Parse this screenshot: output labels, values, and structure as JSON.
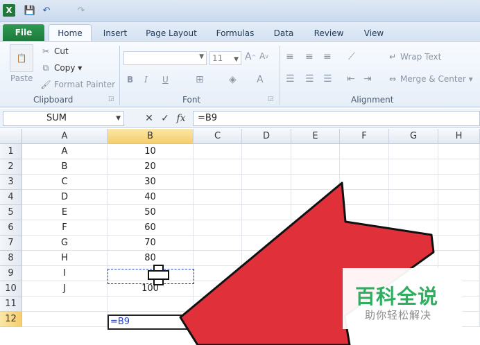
{
  "quick_access": {
    "logo": "X",
    "save": "💾",
    "undo": "↶",
    "redo": "↷"
  },
  "tabs": [
    "File",
    "Home",
    "Insert",
    "Page Layout",
    "Formulas",
    "Data",
    "Review",
    "View"
  ],
  "clipboard": {
    "paste": "Paste",
    "cut": "Cut",
    "copy": "Copy ▾",
    "format_painter": "Format Painter",
    "label": "Clipboard"
  },
  "font": {
    "size": "11",
    "label": "Font",
    "bold": "B",
    "italic": "I",
    "underline": "U"
  },
  "alignment": {
    "wrap_text": "Wrap Text",
    "merge_center": "Merge & Center ▾",
    "label": "Alignment"
  },
  "formula_bar": {
    "name_box": "SUM",
    "cancel": "✕",
    "enter": "✓",
    "fx": "fx",
    "formula": "=B9"
  },
  "columns": [
    "A",
    "B",
    "C",
    "D",
    "E",
    "F",
    "G",
    "H"
  ],
  "rows": [
    {
      "n": "1",
      "a": "A",
      "b": "10"
    },
    {
      "n": "2",
      "a": "B",
      "b": "20"
    },
    {
      "n": "3",
      "a": "C",
      "b": "30"
    },
    {
      "n": "4",
      "a": "D",
      "b": "40"
    },
    {
      "n": "5",
      "a": "E",
      "b": "50"
    },
    {
      "n": "6",
      "a": "F",
      "b": "60"
    },
    {
      "n": "7",
      "a": "G",
      "b": "70"
    },
    {
      "n": "8",
      "a": "H",
      "b": "80"
    },
    {
      "n": "9",
      "a": "I",
      "b": ""
    },
    {
      "n": "10",
      "a": "J",
      "b": "100"
    },
    {
      "n": "11",
      "a": "",
      "b": ""
    },
    {
      "n": "12",
      "a": "",
      "b": ""
    }
  ],
  "active_cell": {
    "text": "=B9"
  },
  "watermark": {
    "title": "百科全说",
    "subtitle": "助你轻松解决"
  },
  "colors": {
    "file_tab": "#1d7a3c",
    "arrow": "#e0303a",
    "selection": "#2743c9",
    "header_highlight": "#f5cd6c"
  }
}
